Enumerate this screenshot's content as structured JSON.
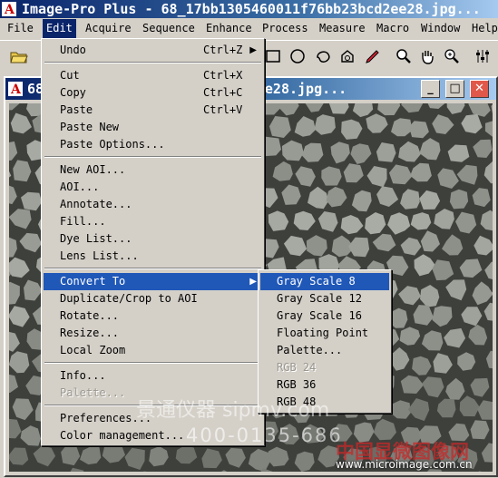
{
  "app": {
    "title": "Image-Pro Plus - 68_17bb1305460011f76bb23bcd2ee28.jpg..."
  },
  "menubar": [
    {
      "label": "File"
    },
    {
      "label": "Edit"
    },
    {
      "label": "Acquire"
    },
    {
      "label": "Sequence"
    },
    {
      "label": "Enhance"
    },
    {
      "label": "Process"
    },
    {
      "label": "Measure"
    },
    {
      "label": "Macro"
    },
    {
      "label": "Window"
    },
    {
      "label": "Help"
    }
  ],
  "toolbar": {
    "icons": [
      "open-folder-icon",
      "rectangle-aoi-icon",
      "ellipse-aoi-icon",
      "irregular-aoi-icon",
      "magic-wand-aoi-icon",
      "edit-pen-icon",
      "magnify-icon",
      "pan-hand-icon",
      "zoom-icon",
      "tool-settings-icon"
    ]
  },
  "child_window": {
    "title": "68_17bb1305460011f76bb23bcd2ee28.jpg...",
    "buttons": {
      "minimize": "_",
      "maximize": "□",
      "close": "✕"
    }
  },
  "edit_menu": {
    "items": [
      {
        "label": "Undo",
        "shortcut": "Ctrl+Z",
        "submenu": true,
        "enabled": true
      },
      {
        "sep": true
      },
      {
        "label": "Cut",
        "shortcut": "Ctrl+X",
        "enabled": true
      },
      {
        "label": "Copy",
        "shortcut": "Ctrl+C",
        "enabled": true
      },
      {
        "label": "Paste",
        "shortcut": "Ctrl+V",
        "enabled": true
      },
      {
        "label": "Paste New",
        "enabled": true
      },
      {
        "label": "Paste Options...",
        "enabled": true
      },
      {
        "sep": true
      },
      {
        "label": "New AOI...",
        "enabled": true
      },
      {
        "label": "AOI...",
        "enabled": true
      },
      {
        "label": "Annotate...",
        "enabled": true
      },
      {
        "label": "Fill...",
        "enabled": true
      },
      {
        "label": "Dye List...",
        "enabled": true
      },
      {
        "label": "Lens List...",
        "enabled": true
      },
      {
        "sep": true
      },
      {
        "label": "Convert To",
        "submenu": true,
        "enabled": true,
        "highlighted": true
      },
      {
        "label": "Duplicate/Crop to AOI",
        "enabled": true
      },
      {
        "label": "Rotate...",
        "enabled": true
      },
      {
        "label": "Resize...",
        "enabled": true
      },
      {
        "label": "Local Zoom",
        "enabled": true
      },
      {
        "sep": true
      },
      {
        "label": "Info...",
        "enabled": true
      },
      {
        "label": "Palette...",
        "enabled": false
      },
      {
        "sep": true
      },
      {
        "label": "Preferences...",
        "enabled": true
      },
      {
        "label": "Color management...",
        "enabled": true
      }
    ]
  },
  "convert_menu": {
    "items": [
      {
        "label": "Gray Scale 8",
        "enabled": true,
        "highlighted": true
      },
      {
        "label": "Gray Scale 12",
        "enabled": true
      },
      {
        "label": "Gray Scale 16",
        "enabled": true
      },
      {
        "label": "Floating Point",
        "enabled": true
      },
      {
        "label": "Palette...",
        "enabled": true
      },
      {
        "label": "RGB 24",
        "enabled": false
      },
      {
        "label": "RGB 36",
        "enabled": true
      },
      {
        "label": "RGB 48",
        "enabled": true
      }
    ]
  },
  "watermark": {
    "brand": "景通仪器 sipmv.com",
    "phone": "400-0135-686",
    "site_cn": "中国显微图像网",
    "site_url": "www.microimage.com.cn"
  },
  "colors": {
    "highlight": "#2058b8",
    "title_bar": "#0a246a",
    "close": "#e0584a"
  }
}
